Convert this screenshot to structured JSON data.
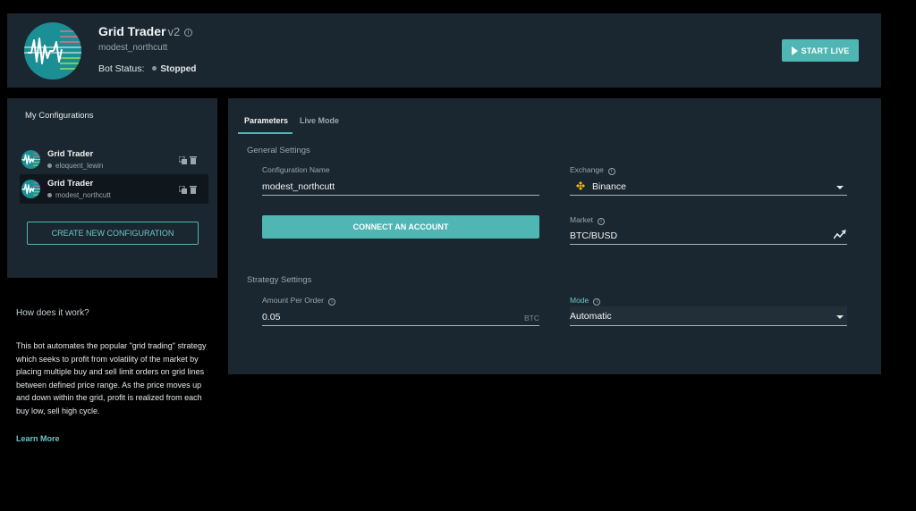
{
  "header": {
    "title": "Grid Trader",
    "version": "v2",
    "username": "modest_northcutt",
    "bot_status_label": "Bot Status:",
    "bot_status_value": "Stopped",
    "start_live_label": "START LIVE",
    "info_icon": "i"
  },
  "sidebar": {
    "title": "My Configurations",
    "configs": [
      {
        "name": "Grid Trader",
        "user": "eloquent_lewin",
        "active": false
      },
      {
        "name": "Grid Trader",
        "user": "modest_northcutt",
        "active": true
      }
    ],
    "create_label": "CREATE NEW CONFIGURATION"
  },
  "info": {
    "title": "How does it work?",
    "text": "This bot automates the popular \"grid trading\" strategy which seeks to profit from volatility of the market by placing multiple buy and sell limit orders on grid lines between defined price range. As the price moves up and down within the grid, profit is realized from each buy low, sell high cycle.",
    "learn_more": "Learn More"
  },
  "main": {
    "tabs": [
      "Parameters",
      "Live Mode"
    ],
    "general_title": "General Settings",
    "config_name_label": "Configuration Name",
    "config_name_value": "modest_northcutt",
    "exchange_label": "Exchange",
    "exchange_value": "Binance",
    "connect_label": "CONNECT AN ACCOUNT",
    "market_label": "Market",
    "market_value": "BTC/BUSD",
    "strategy_title": "Strategy Settings",
    "amount_label": "Amount Per Order",
    "amount_value": "0.05",
    "amount_unit": "BTC",
    "mode_label": "Mode",
    "mode_value": "Automatic",
    "info_icon": "i"
  },
  "colors": {
    "accent": "#4fb6b4",
    "panel": "#1b2730",
    "background": "#000000",
    "binance": "#f0b90b"
  }
}
